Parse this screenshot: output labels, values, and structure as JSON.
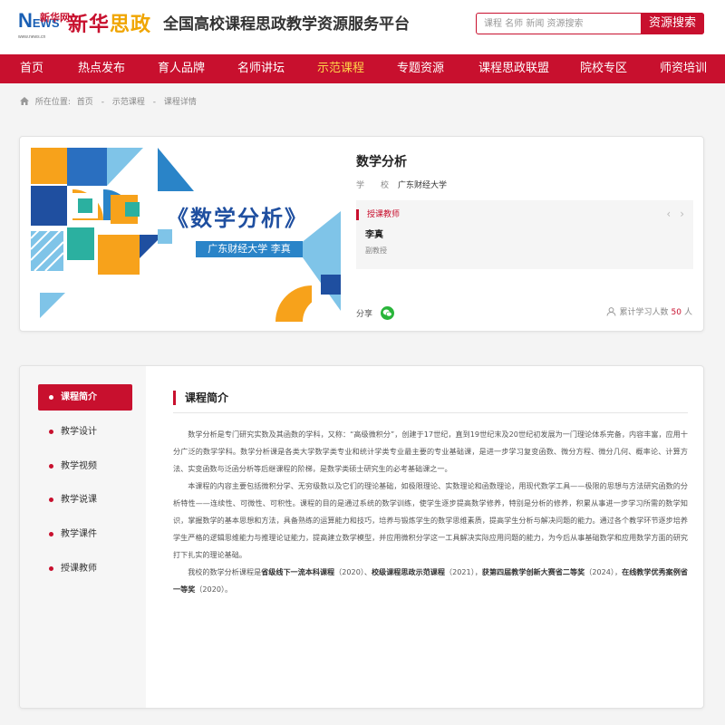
{
  "logo": {
    "news_text": "NEWS",
    "xinhua_text": "新华网",
    "site_url": "www.news.cn",
    "brand_red": "新华",
    "brand_gold": "思政"
  },
  "header": {
    "site_title": "全国高校课程思政教学资源服务平台",
    "search_placeholder": "课程 名师 新闻 资源搜索",
    "search_button": "资源搜索"
  },
  "nav": {
    "items": [
      "首页",
      "热点发布",
      "育人品牌",
      "名师讲坛",
      "示范课程",
      "专题资源",
      "课程思政联盟",
      "院校专区",
      "师资培训"
    ],
    "active_index": 4
  },
  "breadcrumb": {
    "prefix": "所在位置:",
    "items": [
      "首页",
      "示范课程",
      "课程详情"
    ]
  },
  "course": {
    "cover_title": "《数学分析》",
    "cover_subtitle": "广东财经大学 李真",
    "name": "数学分析",
    "school_label": "学　　校",
    "school": "广东财经大学",
    "teacher_section": "授课教师",
    "teacher_name": "李真",
    "teacher_title": "副教授",
    "share_label": "分享",
    "learners_label": "累计学习人数",
    "learners_count": "50",
    "learners_unit": "人",
    "prev_icon": "chevron-left-icon",
    "next_icon": "chevron-right-icon"
  },
  "sidebar": {
    "items": [
      "课程简介",
      "教学设计",
      "教学视频",
      "教学说课",
      "教学课件",
      "授课教师"
    ],
    "active_index": 0
  },
  "section": {
    "title": "课程简介",
    "p1": "数学分析是专门研究实数及其函数的学科，又称：“高级微积分”，创建于17世纪，直到19世纪末及20世纪初发展为一门理论体系完备，内容丰富，应用十分广泛的数学学科。数学分析课是各类大学数学类专业和统计学类专业最主要的专业基础课，是进一步学习复变函数、微分方程、微分几何、概率论、计算方法、实变函数与泛函分析等后继课程的阶梯，是数学类硕士研究生的必考基础课之一。",
    "p2": "本课程的内容主要包括微积分学、无穷级数以及它们的理论基础，如极限理论、实数理论和函数理论，用现代数学工具——极限的思想与方法研究函数的分析特性——连续性、可微性、可积性。课程的目的是通过系统的数学训练，使学生逐步提高数学修养，特别是分析的修养，积累从事进一步学习所需的数学知识，掌握数学的基本思想和方法，具备熟练的运算能力和技巧，培养与锻炼学生的数学思维素质，提高学生分析与解决问题的能力。通过各个教学环节逐步培养学生严格的逻辑思维能力与推理论证能力，提高建立数学模型，并应用微积分学这一工具解决实际应用问题的能力，为今后从事基础数学和应用数学方面的研究打下扎实的理论基础。",
    "p3_intro": "我校的数学分析课程是",
    "award1": "省级线下一流本科课程",
    "award1_year": "（2020）、",
    "award2": "校级课程思政示范课程",
    "award2_year": "（2021），",
    "award3": "获第四届教学创新大赛省二等奖",
    "award3_year": "（2024），",
    "award4": "在线教学优秀案例省一等奖",
    "award4_year": "（2020）。"
  },
  "colors": {
    "brand_red": "#c8102e",
    "nav_active": "#ffd54a",
    "wechat_green": "#29b53a",
    "cover_blue": "#1f4fa0"
  }
}
